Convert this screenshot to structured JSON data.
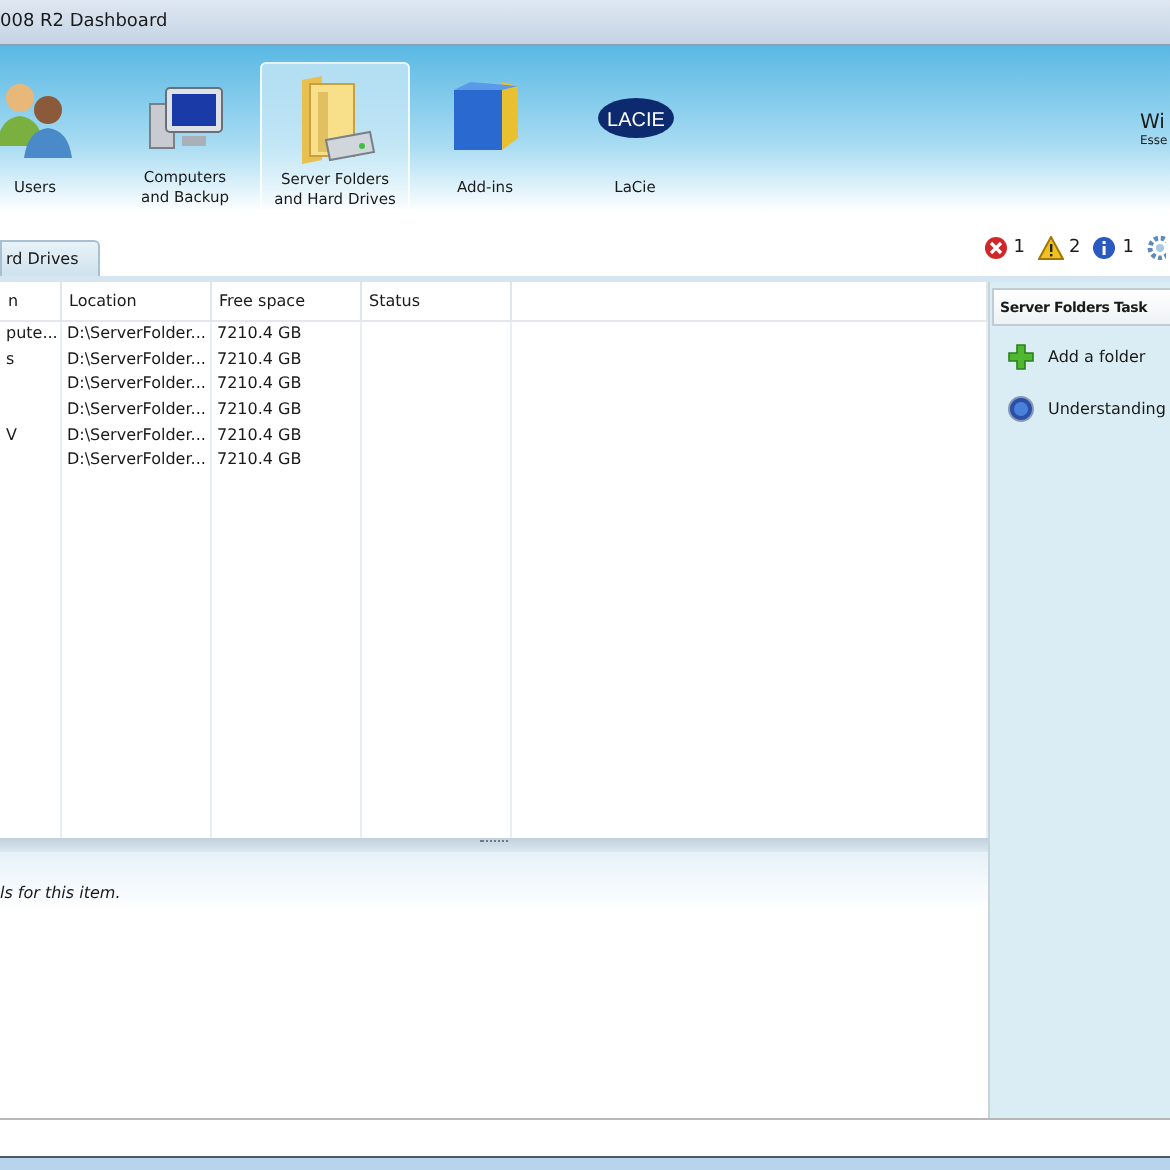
{
  "window": {
    "title": "008 R2 Dashboard"
  },
  "nav": [
    {
      "label": "Users",
      "selected": false
    },
    {
      "label": "Computers\nand Backup",
      "selected": false
    },
    {
      "label": "Server Folders\nand Hard Drives",
      "selected": true
    },
    {
      "label": "Add-ins",
      "selected": false
    },
    {
      "label": "LaCie",
      "logo_text": "LACIE",
      "selected": false
    }
  ],
  "brand": {
    "line_1": "Wi",
    "line_2": "Esse"
  },
  "tabs": [
    {
      "label": "rd Drives"
    }
  ],
  "alerts": [
    {
      "kind": "error",
      "count": "1"
    },
    {
      "kind": "warning",
      "count": "2"
    },
    {
      "kind": "info",
      "count": "1"
    }
  ],
  "table": {
    "columns": [
      "n",
      "Location",
      "Free space",
      "Status"
    ],
    "rows": [
      {
        "cells": [
          "pute...",
          "D:\\ServerFolder...",
          "7210.4 GB"
        ]
      },
      {
        "cells": [
          "s",
          "D:\\ServerFolder...",
          "7210.4 GB"
        ]
      },
      {
        "cells": [
          null,
          "D:\\ServerFolder...",
          "7210.4 GB"
        ]
      },
      {
        "cells": [
          null,
          "D:\\ServerFolder...",
          "7210.4 GB"
        ]
      },
      {
        "cells": [
          "V",
          "D:\\ServerFolder...",
          "7210.4 GB"
        ]
      },
      {
        "cells": [
          null,
          "D:\\ServerFolder...",
          "7210.4 GB"
        ]
      }
    ]
  },
  "details": {
    "text": "ls for this item."
  },
  "tasks": {
    "title": "Server Folders Task",
    "items": [
      {
        "label": "Add a folder"
      },
      {
        "label": "Understanding"
      }
    ]
  }
}
